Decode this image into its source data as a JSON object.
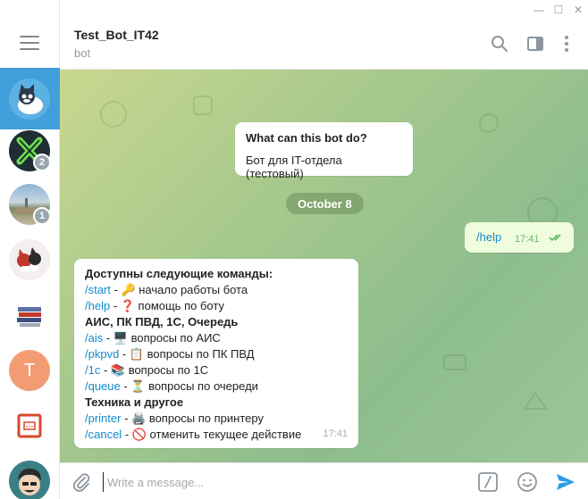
{
  "window": {
    "minimize": "—",
    "maximize": "☐",
    "close": "✕"
  },
  "sidebar": {
    "chats": [
      {
        "name": "cat-bot-avatar",
        "badge": ""
      },
      {
        "name": "x-avatar",
        "badge": "2"
      },
      {
        "name": "photo-avatar",
        "badge": "1"
      },
      {
        "name": "cats-avatar",
        "badge": ""
      },
      {
        "name": "books-avatar",
        "badge": ""
      },
      {
        "name": "t-avatar",
        "letter": "T",
        "color": "#f39c73"
      },
      {
        "name": "code-avatar",
        "badge": ""
      },
      {
        "name": "face-avatar",
        "badge": ""
      }
    ]
  },
  "header": {
    "title": "Test_Bot_IT42",
    "subtitle": "bot"
  },
  "info_card": {
    "heading": "What can this bot do?",
    "text": "Бот для IT-отдела (тестовый)"
  },
  "date_separator": "October 8",
  "outgoing": {
    "text": "/help",
    "time": "17:41"
  },
  "incoming": {
    "time": "17:41",
    "lines": [
      {
        "bold": "Доступны следующие команды:"
      },
      {
        "cmd": "/start",
        "rest": " - 🔑 начало работы бота"
      },
      {
        "cmd": "/help",
        "rest": " - ❓ помощь по боту"
      },
      {
        "bold": "АИС, ПК ПВД, 1С, Очередь"
      },
      {
        "cmd": "/ais",
        "rest": " - 🖥️ вопросы по АИС"
      },
      {
        "cmd": "/pkpvd",
        "rest": " - 📋 вопросы по ПК ПВД"
      },
      {
        "cmd": "/1c",
        "rest": " - 📚 вопросы по 1С"
      },
      {
        "cmd": "/queue",
        "rest": " - ⏳ вопросы по очереди"
      },
      {
        "bold": "Техника и другое"
      },
      {
        "cmd": "/printer",
        "rest": " - 🖨️ вопросы по принтеру"
      },
      {
        "cmd": "/cancel",
        "rest": " - 🚫 отменить текущее действие"
      }
    ]
  },
  "composer": {
    "placeholder": "Write a message..."
  },
  "colors": {
    "accent": "#419fd9",
    "link": "#168acd",
    "send": "#2e9be6"
  }
}
